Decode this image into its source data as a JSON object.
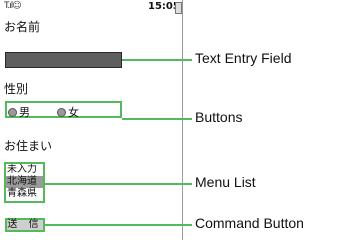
{
  "status": {
    "signal": "T.ıl☺",
    "time": "15:05"
  },
  "form": {
    "name_label": "お名前",
    "name_value": "",
    "gender_label": "性別",
    "gender_options": [
      "男",
      "女"
    ],
    "address_label": "お住まい",
    "address_options": [
      "未入力",
      "北海道",
      "青森県"
    ],
    "submit_label": "送 信"
  },
  "annotations": {
    "text_entry": "Text Entry Field",
    "buttons": "Buttons",
    "menu_list": "Menu List",
    "command_button": "Command Button"
  },
  "colors": {
    "accent": "#54b95a",
    "field": "#5e5e5e"
  }
}
